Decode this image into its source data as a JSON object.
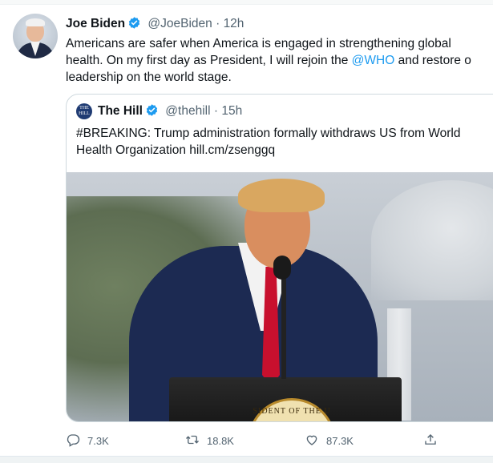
{
  "tweet": {
    "author_name": "Joe Biden",
    "author_handle": "@JoeBiden",
    "separator": "·",
    "time": "12h",
    "text_lines": [
      {
        "before": "Americans are safer when America is engaged in strengthening global",
        "mention": "",
        "after": ""
      },
      {
        "before": "health. On my first day as President, I will rejoin the ",
        "mention": "@WHO",
        "after": " and restore o"
      },
      {
        "before": "leadership on the world stage.",
        "mention": "",
        "after": ""
      }
    ]
  },
  "quoted_tweet": {
    "author_name": "The Hill",
    "author_handle": "@thehill",
    "separator": "·",
    "time": "15h",
    "avatar_text": "THE HILL",
    "text_lines": [
      "#BREAKING: Trump administration formally withdraws US from World",
      "Health Organization hill.cm/zsenggq"
    ],
    "image": {
      "seal_text": "SIDENT OF THE U"
    }
  },
  "actions": {
    "reply_count": "7.3K",
    "retweet_count": "18.8K",
    "like_count": "87.3K",
    "icons": [
      "reply-icon",
      "retweet-icon",
      "like-icon",
      "share-icon"
    ]
  },
  "colors": {
    "link": "#1d9bf0",
    "verified": "#1d9bf0",
    "secondary_text": "#536471"
  }
}
